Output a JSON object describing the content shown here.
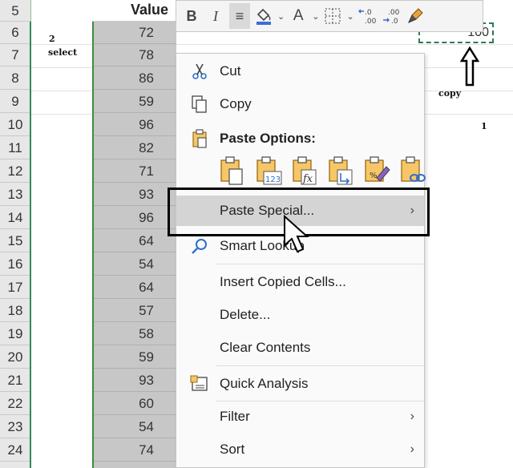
{
  "sheet": {
    "column_header": "Value",
    "row_numbers": [
      "5",
      "6",
      "7",
      "8",
      "9",
      "10",
      "11",
      "12",
      "13",
      "14",
      "15",
      "16",
      "17",
      "18",
      "19",
      "20",
      "21",
      "22",
      "23",
      "24"
    ],
    "values": [
      "72",
      "78",
      "86",
      "59",
      "96",
      "82",
      "71",
      "93",
      "96",
      "64",
      "54",
      "64",
      "57",
      "58",
      "59",
      "93",
      "60",
      "54",
      "74"
    ]
  },
  "annotations": {
    "step2_num": "2",
    "step2_word": "select",
    "copy_word": "copy",
    "step1_num": "1"
  },
  "copy_cell_value": "100",
  "mini_toolbar": {
    "bold": "B",
    "italic": "I",
    "align": "≡",
    "font_color_letter": "A",
    "fill_color": "#3b6fd8",
    "font_color": "#c0392b"
  },
  "context_menu": {
    "cut": "Cut",
    "copy": "Copy",
    "paste_options": "Paste Options:",
    "paste_special": "Paste Special...",
    "smart_lookup": "Smart Lookup",
    "insert_copied_cells": "Insert Copied Cells...",
    "delete": "Delete...",
    "clear_contents": "Clear Contents",
    "quick_analysis": "Quick Analysis",
    "filter": "Filter",
    "sort": "Sort"
  }
}
